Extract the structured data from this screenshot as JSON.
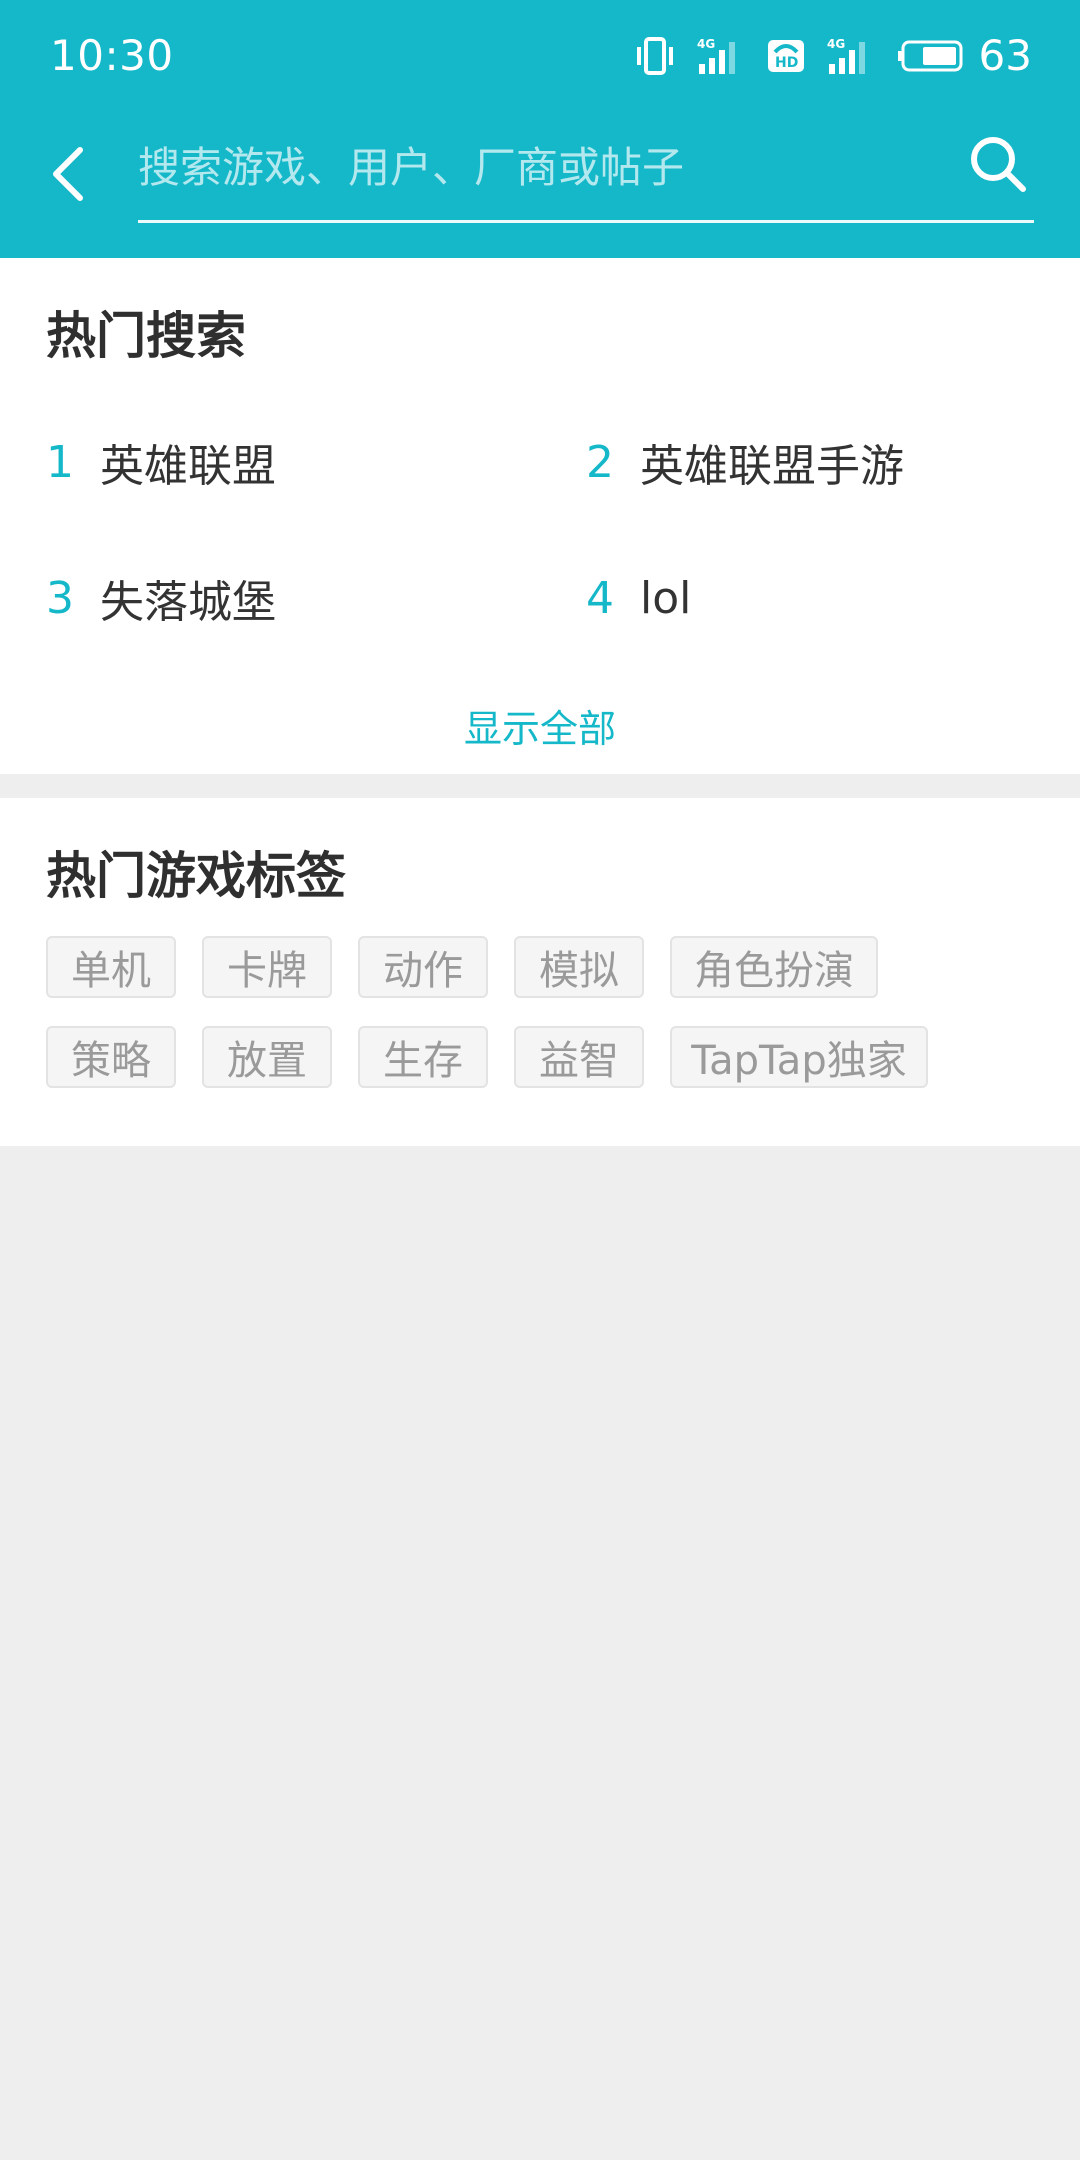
{
  "status_bar": {
    "time": "10:30",
    "battery_percent": "63",
    "icons": [
      "vibrate-icon",
      "signal-4g-icon",
      "hd-call-icon",
      "signal-4g-icon",
      "battery-icon"
    ],
    "net_label_1": "4G",
    "net_label_2": "4G",
    "hd_label": "HD"
  },
  "search": {
    "placeholder": "搜索游戏、用户、厂商或帖子",
    "value": ""
  },
  "hot_search": {
    "title": "热门搜索",
    "items": [
      {
        "rank": "1",
        "term": "英雄联盟"
      },
      {
        "rank": "2",
        "term": "英雄联盟手游"
      },
      {
        "rank": "3",
        "term": "失落城堡"
      },
      {
        "rank": "4",
        "term": "lol"
      }
    ],
    "show_all": "显示全部"
  },
  "hot_tags": {
    "title": "热门游戏标签",
    "rows": [
      [
        "单机",
        "卡牌",
        "动作",
        "模拟",
        "角色扮演"
      ],
      [
        "策略",
        "放置",
        "生存",
        "益智",
        "TapTap独家"
      ]
    ]
  },
  "colors": {
    "accent": "#15b8c9",
    "background": "#eeeeee",
    "tag_text": "#9a9a9a"
  }
}
